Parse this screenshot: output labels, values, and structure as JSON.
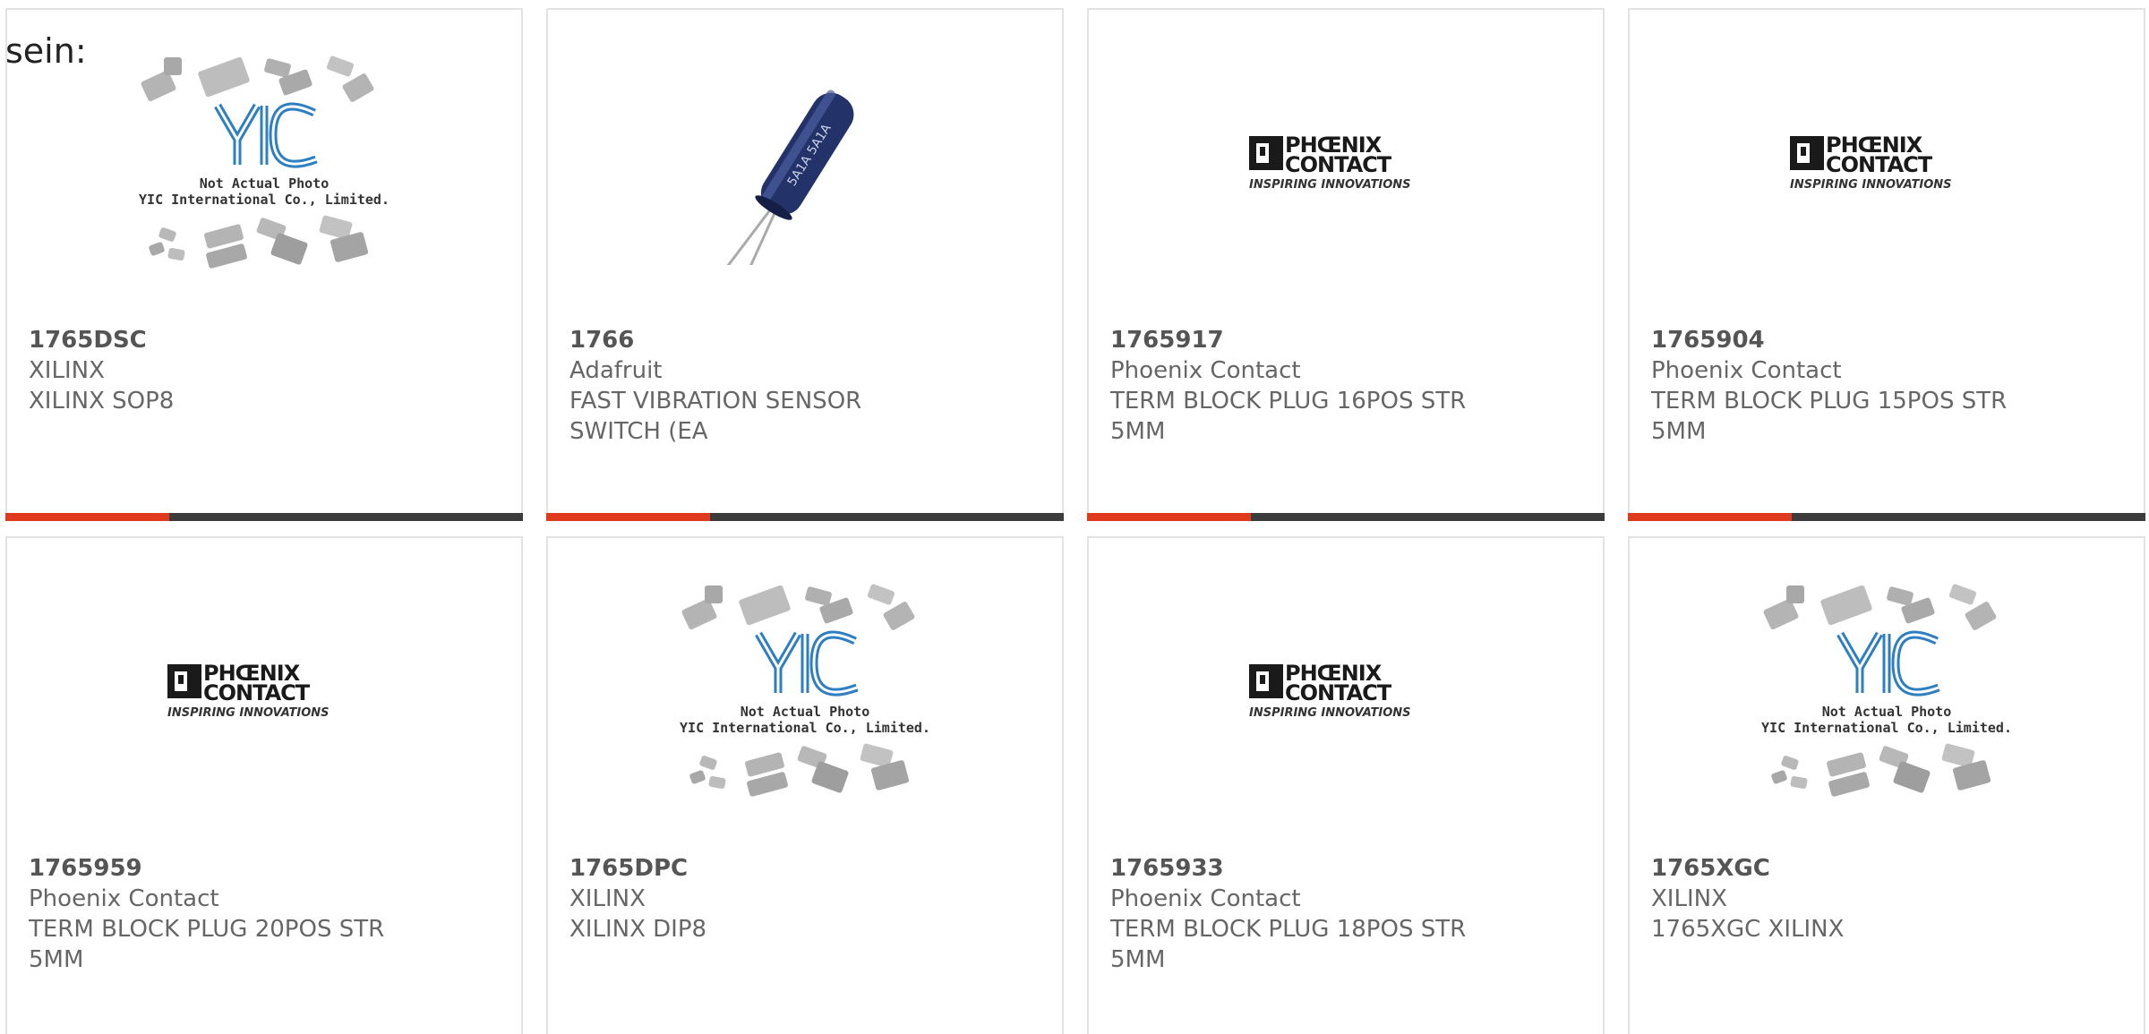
{
  "intro_text": "sein:",
  "accent_color": "#e03a1e",
  "bar_color": "#3c3c3c",
  "logos": {
    "yic": {
      "letters": "YIC",
      "line1": "Not Actual Photo",
      "line2": "YIC International Co., Limited."
    },
    "phoenix": {
      "line1": "PHŒNIX",
      "line2": "CONTACT",
      "tagline": "INSPIRING INNOVATIONS"
    },
    "sensor": {
      "label": "5A1A 5A1A"
    }
  },
  "products": [
    {
      "part": "1765DSC",
      "maker": "XILINX",
      "description": "XILINX SOP8",
      "image": "yic-placeholder",
      "has_bar": true
    },
    {
      "part": "1766",
      "maker": "Adafruit",
      "description": "FAST VIBRATION SENSOR SWITCH (EA",
      "image": "vibration-sensor-photo",
      "has_bar": true
    },
    {
      "part": "1765917",
      "maker": "Phoenix Contact",
      "description": "TERM BLOCK PLUG 16POS STR 5MM",
      "image": "phoenix-contact-logo",
      "has_bar": true
    },
    {
      "part": "1765904",
      "maker": "Phoenix Contact",
      "description": "TERM BLOCK PLUG 15POS STR 5MM",
      "image": "phoenix-contact-logo",
      "has_bar": true
    },
    {
      "part": "1765959",
      "maker": "Phoenix Contact",
      "description": "TERM BLOCK PLUG 20POS STR 5MM",
      "image": "phoenix-contact-logo",
      "has_bar": false
    },
    {
      "part": "1765DPC",
      "maker": "XILINX",
      "description": "XILINX DIP8",
      "image": "yic-placeholder",
      "has_bar": false
    },
    {
      "part": "1765933",
      "maker": "Phoenix Contact",
      "description": "TERM BLOCK PLUG 18POS STR 5MM",
      "image": "phoenix-contact-logo",
      "has_bar": false
    },
    {
      "part": "1765XGC",
      "maker": "XILINX",
      "description": "1765XGC XILINX",
      "image": "yic-placeholder",
      "has_bar": false
    }
  ]
}
